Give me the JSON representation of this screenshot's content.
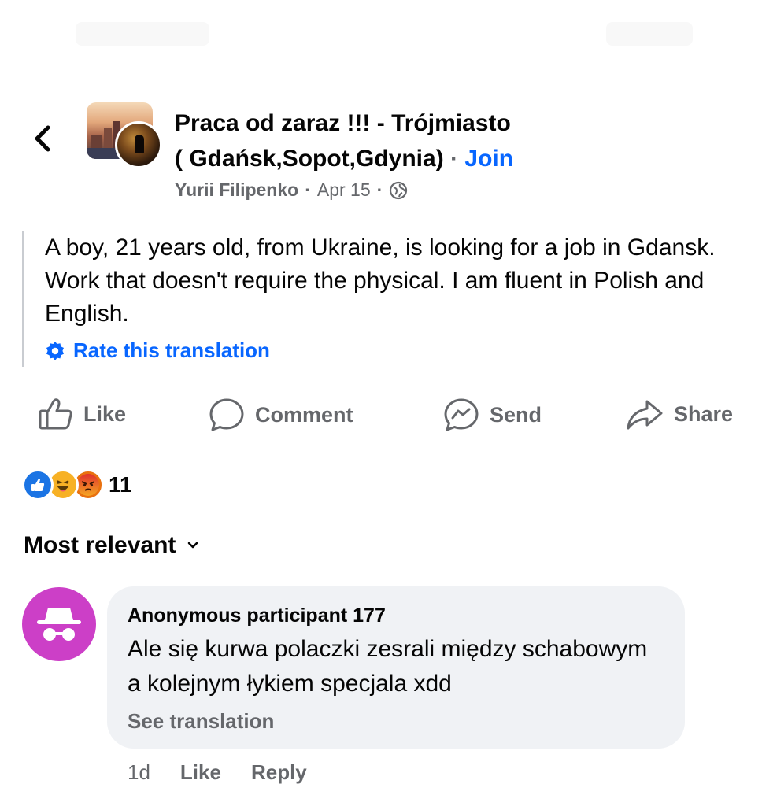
{
  "group": {
    "title_line1": "Praca od zaraz !!! - Trójmiasto",
    "title_line2": "( Gdańsk,Sopot,Gdynia)",
    "separator": "·",
    "join_label": "Join"
  },
  "post": {
    "author": "Yurii Filipenko",
    "date": "Apr 15",
    "separator": "·",
    "privacy_icon": "globe-icon",
    "text": "A boy, 21 years old, from Ukraine, is looking for a job in Gdansk. Work that doesn't require the physical. I am fluent in Polish and English.",
    "rate_translation_label": "Rate this translation"
  },
  "actions": {
    "like": "Like",
    "comment": "Comment",
    "send": "Send",
    "share": "Share"
  },
  "reactions": {
    "types": [
      "like",
      "haha",
      "angry"
    ],
    "count": "11"
  },
  "comments_sort": {
    "label": "Most relevant"
  },
  "comment": {
    "author": "Anonymous participant 177",
    "text": "Ale się kurwa polaczki zesrali między schabowym a kolejnym łykiem specjala xdd",
    "see_translation": "See translation",
    "time": "1d",
    "like_label": "Like",
    "reply_label": "Reply"
  },
  "colors": {
    "accent": "#0866ff",
    "secondary_text": "#65676b",
    "bubble_bg": "#f0f2f5",
    "anon_avatar": "#cc3fc7"
  }
}
